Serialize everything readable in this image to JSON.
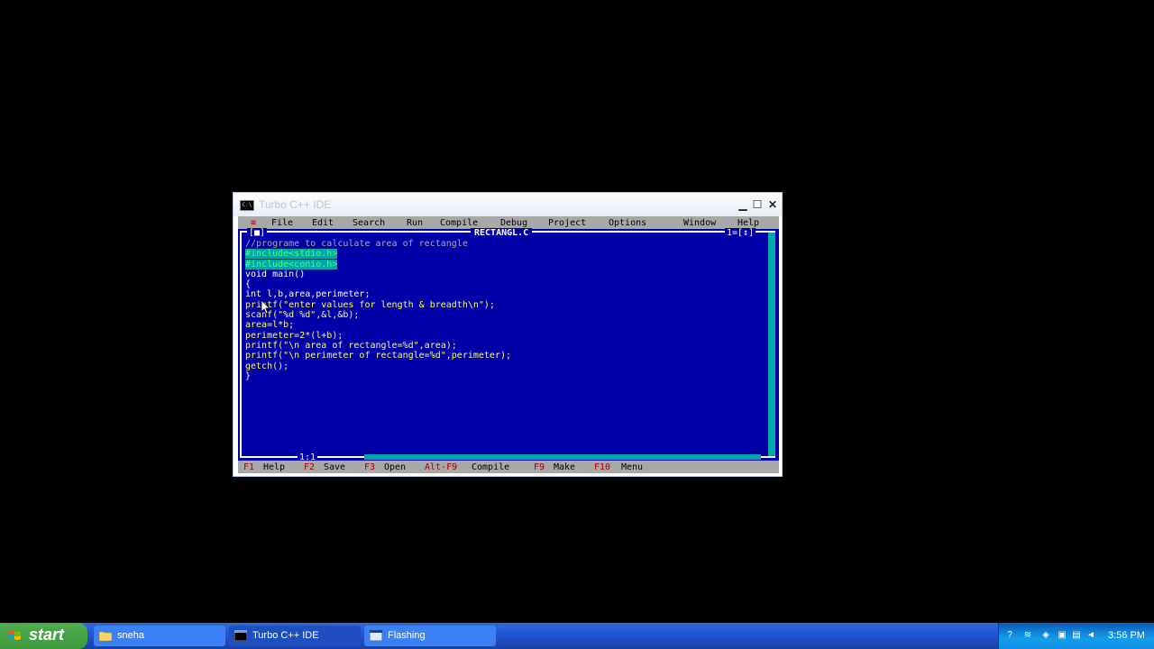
{
  "window": {
    "title": "Turbo C++ IDE"
  },
  "menu": {
    "system": "≡",
    "items": [
      "File",
      "Edit",
      "Search",
      "Run",
      "Compile",
      "Debug",
      "Project",
      "Options",
      "Window",
      "Help"
    ]
  },
  "editor": {
    "close_box": "[■]",
    "filename": "RECTANGL.C",
    "window_number": "1=[↕]",
    "position": "1:1",
    "lines": [
      "//programe to calculate area of rectangle",
      "#include<stdio.h>",
      "#include<conio.h>",
      "void main()",
      "{",
      "int l,b,area,perimeter;",
      "printf(\"enter values for length & breadth\\n\");",
      "scanf(\"%d %d\",&l,&b);",
      "area=l*b;",
      "perimeter=2*(l+b);",
      "printf(\"\\n area of rectangle=%d\",area);",
      "printf(\"\\n perimeter of rectangle=%d\",perimeter);",
      "getch();",
      "}"
    ]
  },
  "status": {
    "items": [
      {
        "key": "F1",
        "action": "Help"
      },
      {
        "key": "F2",
        "action": "Save"
      },
      {
        "key": "F3",
        "action": "Open"
      },
      {
        "key": "Alt-F9",
        "action": "Compile"
      },
      {
        "key": "F9",
        "action": "Make"
      },
      {
        "key": "F10",
        "action": "Menu"
      }
    ]
  },
  "taskbar": {
    "start": "start",
    "tasks": [
      {
        "label": "sneha"
      },
      {
        "label": "Turbo C++ IDE"
      },
      {
        "label": "Flashing"
      }
    ],
    "clock": "3:56 PM"
  },
  "colors": {
    "console_bg": "#0000a8",
    "menu_bg": "#a8a8a8",
    "hotkey": "#a80000",
    "taskbar": "#2157d7",
    "start_green": "#3c9a3c"
  }
}
